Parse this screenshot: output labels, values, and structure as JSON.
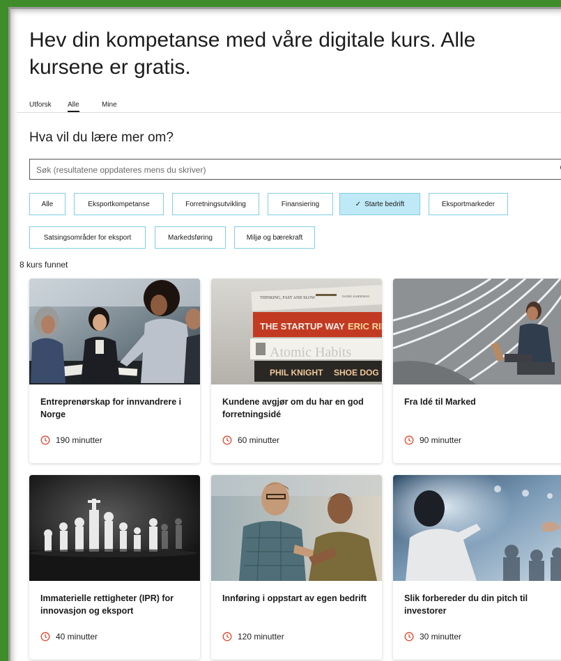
{
  "headline": "Hev din kompetanse med våre digitale kurs. Alle kursene er gratis.",
  "tabs": [
    {
      "label": "Utforsk"
    },
    {
      "label": "Alle"
    },
    {
      "label": "Mine"
    }
  ],
  "active_tab": "Alle",
  "subheading": "Hva vil du lære mer om?",
  "search": {
    "placeholder": "Søk (resultatene oppdateres mens du skriver)",
    "icon": "search-icon"
  },
  "filters": [
    {
      "label": "Alle",
      "selected": false
    },
    {
      "label": "Eksportkompetanse",
      "selected": false
    },
    {
      "label": "Forretningsutvikling",
      "selected": false
    },
    {
      "label": "Finansiering",
      "selected": false
    },
    {
      "label": "Starte bedrift",
      "selected": true
    },
    {
      "label": "Eksportmarkeder",
      "selected": false
    },
    {
      "label": "Satsingsområder for eksport",
      "selected": false
    },
    {
      "label": "Markedsføring",
      "selected": false
    },
    {
      "label": "Miljø og bærekraft",
      "selected": false
    }
  ],
  "results_count": "8 kurs funnet",
  "courses": [
    {
      "title": "Entreprenørskap for innvandrere i Norge",
      "duration": "190 minutter",
      "image": "meeting-photo"
    },
    {
      "title": "Kundene avgjør om du har en god forretningsidé",
      "duration": "60 minutter",
      "image": "books-photo",
      "book_spines": [
        "THINKING, FAST AND SLOW",
        "DANIEL KAHNEMAN",
        "THE STARTUP WAY",
        "ERIC RIES",
        "Atomic Habits",
        "PHIL KNIGHT",
        "SHOE DOG"
      ]
    },
    {
      "title": "Fra Idé til Marked",
      "duration": "90 minutter",
      "image": "road-lines-photo"
    },
    {
      "title": "Immaterielle rettigheter (IPR) for innovasjon og eksport",
      "duration": "40 minutter",
      "image": "chess-photo"
    },
    {
      "title": "Innføring i oppstart av egen bedrift",
      "duration": "120 minutter",
      "image": "two-men-photo"
    },
    {
      "title": "Slik forbereder du din pitch til investorer",
      "duration": "30 minutter",
      "image": "pitch-photo"
    }
  ],
  "colors": {
    "frame": "#3e8c2a",
    "chip_border": "#7fcde5",
    "chip_selected": "#bfe9f6",
    "clock_icon": "#e0452b"
  }
}
